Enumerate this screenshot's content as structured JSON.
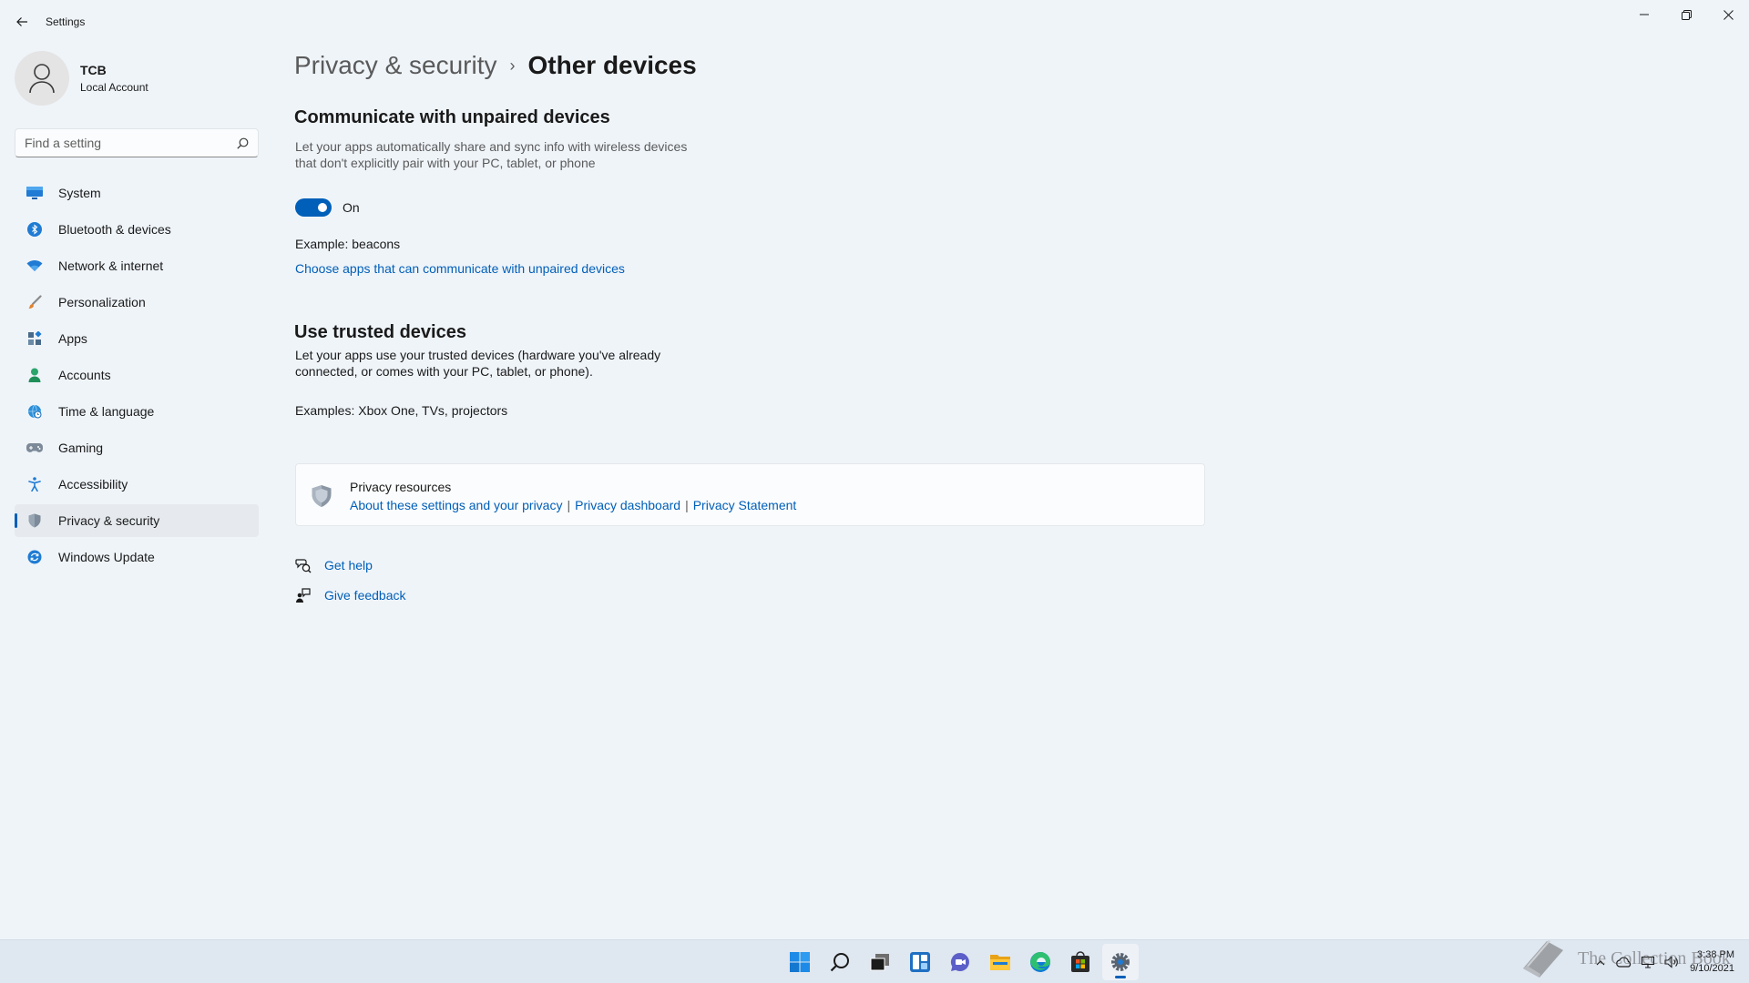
{
  "window": {
    "title": "Settings"
  },
  "profile": {
    "name": "TCB",
    "account_type": "Local Account"
  },
  "search": {
    "placeholder": "Find a setting"
  },
  "sidebar": {
    "items": [
      {
        "label": "System",
        "icon": "monitor-icon"
      },
      {
        "label": "Bluetooth & devices",
        "icon": "bluetooth-icon"
      },
      {
        "label": "Network & internet",
        "icon": "wifi-icon"
      },
      {
        "label": "Personalization",
        "icon": "brush-icon"
      },
      {
        "label": "Apps",
        "icon": "apps-icon"
      },
      {
        "label": "Accounts",
        "icon": "person-icon"
      },
      {
        "label": "Time & language",
        "icon": "globe-clock-icon"
      },
      {
        "label": "Gaming",
        "icon": "gamepad-icon"
      },
      {
        "label": "Accessibility",
        "icon": "accessibility-icon"
      },
      {
        "label": "Privacy & security",
        "icon": "shield-icon",
        "active": true
      },
      {
        "label": "Windows Update",
        "icon": "update-icon"
      }
    ]
  },
  "breadcrumb": {
    "parent": "Privacy & security",
    "separator": "›",
    "current": "Other devices"
  },
  "unpaired": {
    "heading": "Communicate with unpaired devices",
    "description_line1": "Let your apps automatically share and sync info with wireless devices",
    "description_line2": "that don't explicitly pair with your PC, tablet, or phone",
    "toggle_state": "On",
    "example": "Example: beacons",
    "link": "Choose apps that can communicate with unpaired devices"
  },
  "trusted": {
    "heading": "Use trusted devices",
    "description_line1": "Let your apps use your trusted devices (hardware you've already",
    "description_line2": "connected, or comes with your PC, tablet, or phone).",
    "example": "Examples: Xbox One, TVs, projectors"
  },
  "resources": {
    "title": "Privacy resources",
    "links": [
      "About these settings and your privacy",
      "Privacy dashboard",
      "Privacy Statement"
    ],
    "separator": "|"
  },
  "help": {
    "get_help": "Get help",
    "give_feedback": "Give feedback"
  },
  "taskbar": {
    "apps": [
      "start-icon",
      "search-icon",
      "task-view-icon",
      "widgets-icon",
      "chat-icon",
      "file-explorer-icon",
      "edge-icon",
      "store-icon",
      "settings-icon"
    ],
    "clock_time": "3:38 PM",
    "clock_date": "9/10/2021"
  },
  "watermark": {
    "text": "The Collection Book"
  },
  "colors": {
    "accent": "#005fb8",
    "background": "#eff4f9",
    "taskbar": "#dfe7f1"
  }
}
